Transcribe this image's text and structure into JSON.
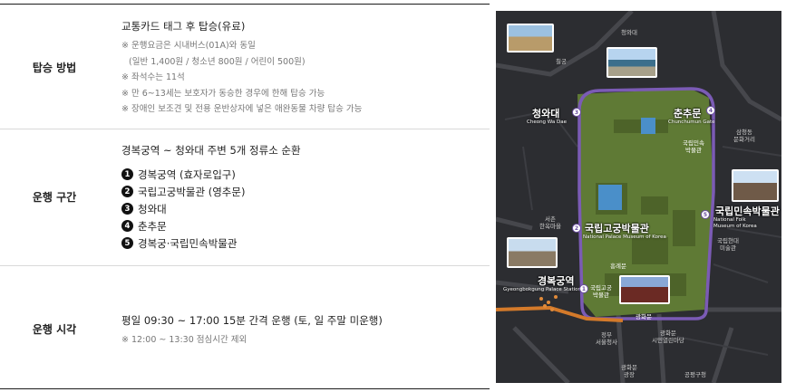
{
  "rows": {
    "boarding": {
      "header": "탑승 방법",
      "lead": "교통카드 태그 후 탑승(유료)",
      "notes": [
        "※ 운행요금은 시내버스(01A)와 동일",
        "(일반 1,400원 / 청소년 800원 / 어린이 500원)",
        "※ 좌석수는 11석",
        "※ 만 6~13세는 보호자가 동승한 경우에 한해 탑승 가능",
        "※ 장애인 보조견 및 전용 운반상자에 넣은 애완동물 차량 탑승 가능"
      ]
    },
    "route": {
      "header": "운행 구간",
      "lead": "경복궁역 ~ 청와대 주변 5개 정류소 순환",
      "stops": [
        {
          "num": "1",
          "name": "경복궁역 (효자로입구)"
        },
        {
          "num": "2",
          "name": "국립고궁박물관 (영추문)"
        },
        {
          "num": "3",
          "name": "청와대"
        },
        {
          "num": "4",
          "name": "춘추문"
        },
        {
          "num": "5",
          "name": "경복궁·국립민속박물관"
        }
      ]
    },
    "time": {
      "header": "운행 시각",
      "lead": "평일 09:30 ~ 17:00 15분 간격 운행 (토, 일 주말 미운행)",
      "note": "※ 12:00 ~ 13:30 점심시간 제외"
    }
  },
  "map": {
    "colors": {
      "route": "#7b5bb5",
      "park": "#5f7a35",
      "bg": "#2c2d31",
      "road": "#4a4b50"
    },
    "labels": {
      "cheongwadae_top": "청와대",
      "chilgung": "칠궁",
      "cheongwadae": "청와대",
      "cheongwadae_en": "Cheong Wa Dae",
      "chunchumun": "춘추문",
      "chunchumun_en": "Chunchumun Gate",
      "samcheong": "삼청동\n문화거리",
      "folk_small": "국립민속\n박물관",
      "folk": "국립민속박물관",
      "folk_en": "National Folk\nMuseum of Korea",
      "palace_museum": "국립고궁박물관",
      "palace_museum_en": "National Palace Museum of Korea",
      "seochon": "서촌\n한옥마을",
      "mmca": "국립현대\n미술관",
      "heungnyemun": "흥례문",
      "gyeongbokgung": "경복궁역",
      "gyeongbokgung_en": "Gyeongbokgung Palace Station",
      "palace_small": "국립고궁\n박물관",
      "gwanghwamun_small": "광화문",
      "govt": "정부\n서울청사",
      "gwanghwamun_st": "광화문\n시민열린마당",
      "gwanghwamun_sq": "광화문\n광장",
      "gongpyeong": "공평구청"
    }
  }
}
